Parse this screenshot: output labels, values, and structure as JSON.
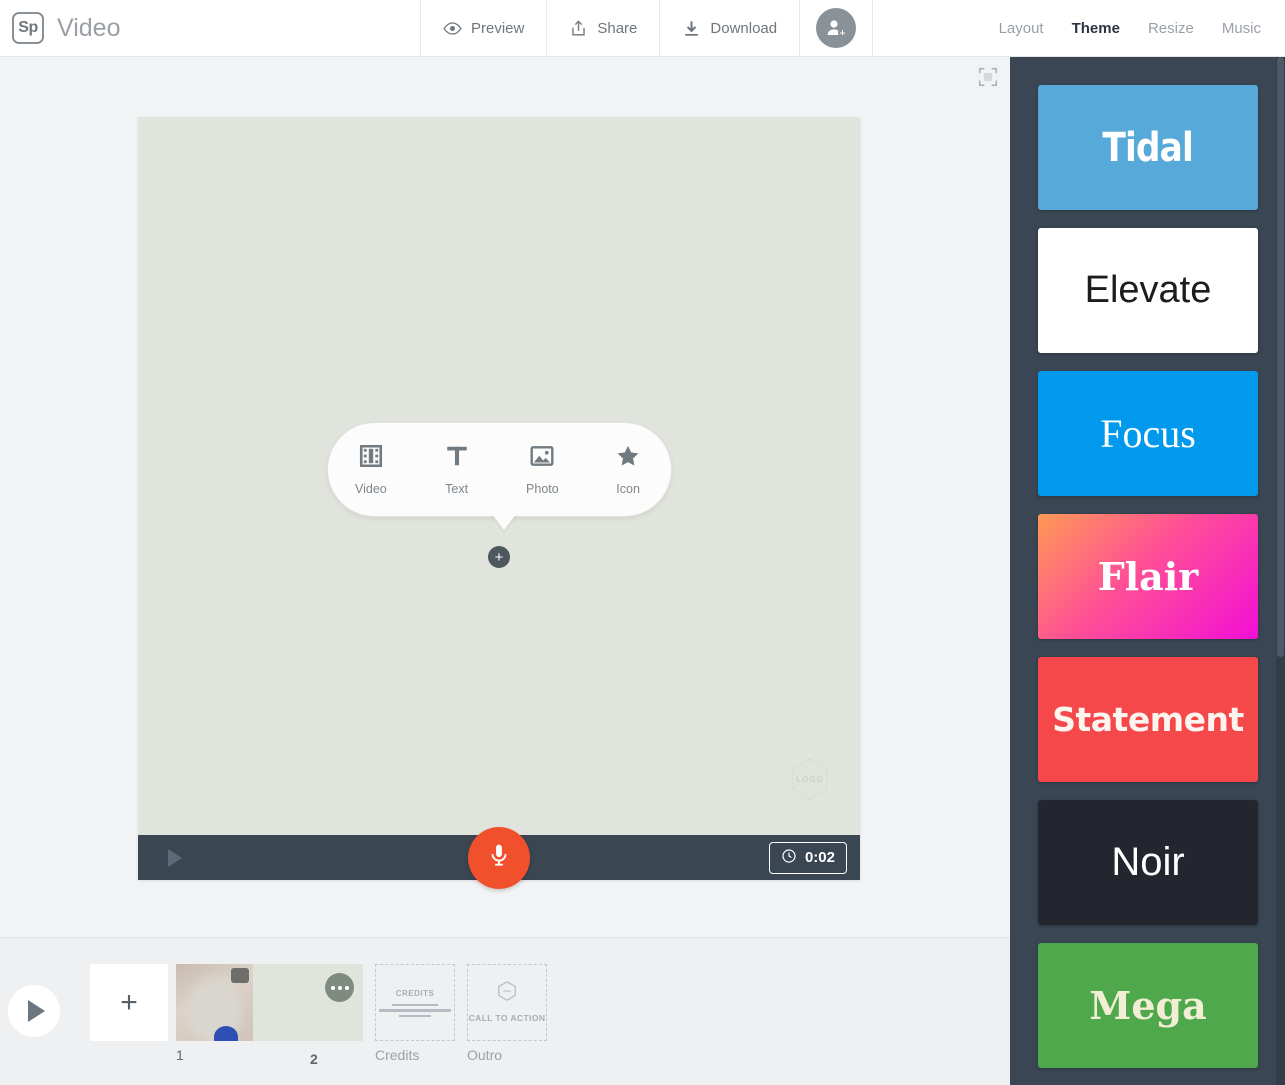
{
  "app": {
    "logo_text": "Sp",
    "title": "Video"
  },
  "toolbar": {
    "preview_label": "Preview",
    "share_label": "Share",
    "download_label": "Download",
    "invite_icon": "add-person-icon"
  },
  "topnav": {
    "items": [
      {
        "label": "Layout",
        "active": false
      },
      {
        "label": "Theme",
        "active": true
      },
      {
        "label": "Resize",
        "active": false
      },
      {
        "label": "Music",
        "active": false
      }
    ]
  },
  "stage": {
    "fullscreen_icon": "fullscreen-icon",
    "canvas_color": "#e0e4dc",
    "logo_watermark_text": "LOGO",
    "add_popover": {
      "items": [
        {
          "label": "Video",
          "icon": "film-icon"
        },
        {
          "label": "Text",
          "icon": "text-icon"
        },
        {
          "label": "Photo",
          "icon": "photo-icon"
        },
        {
          "label": "Icon",
          "icon": "star-icon"
        }
      ],
      "plus_label": "+"
    },
    "player": {
      "play_icon": "play-icon",
      "record_icon": "microphone-icon",
      "record_color": "#f1502c",
      "duration": "0:02",
      "clock_icon": "clock-icon"
    }
  },
  "timeline": {
    "play_icon": "play-icon",
    "add_slide_label": "+",
    "slides": [
      {
        "number": "1",
        "type": "photo"
      },
      {
        "number": "2",
        "type": "selected",
        "menu_icon": "more-options-icon"
      }
    ],
    "placeholders": [
      {
        "label": "Credits",
        "inner_text": "CREDITS"
      },
      {
        "label": "Outro",
        "inner_text": "CALL TO ACTION",
        "icon": "logo-hex-icon"
      }
    ]
  },
  "theme_panel": {
    "background": "#3a4653",
    "themes": [
      {
        "name": "Tidal",
        "bg": "#56a9d8",
        "fg": "#ffffff"
      },
      {
        "name": "Elevate",
        "bg": "#ffffff",
        "fg": "#1d1d1d"
      },
      {
        "name": "Focus",
        "bg": "#0099ec",
        "fg": "#ffffff"
      },
      {
        "name": "Flair",
        "bg": "linear-gradient(135deg, #ff9a55 0%, #ff4f96 45%, #f20fd6 100%)",
        "fg": "#ffffff"
      },
      {
        "name": "Statement",
        "bg": "#f4484a",
        "fg": "#fdf4ef"
      },
      {
        "name": "Noir",
        "bg": "#23262e",
        "fg": "#ffffff"
      },
      {
        "name": "Mega",
        "bg": "#4fa94c",
        "fg": "#f2eed6"
      }
    ]
  }
}
